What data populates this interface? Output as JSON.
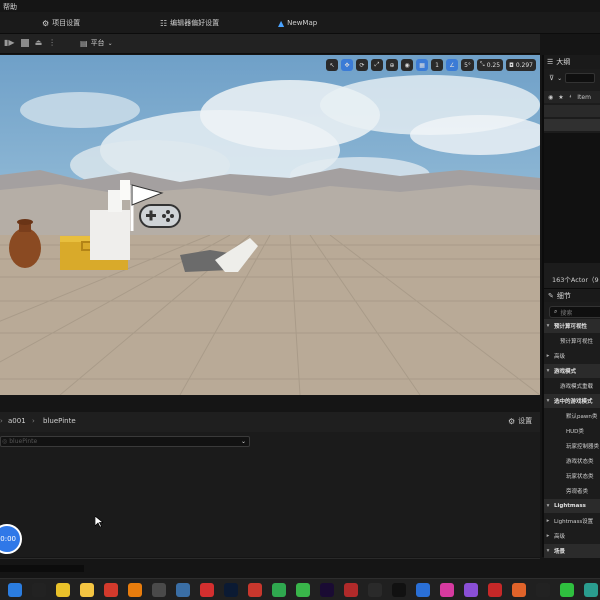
{
  "menubar": {
    "help_label": "帮助"
  },
  "tabs": [
    {
      "label": "项目设置"
    },
    {
      "label": "编辑器偏好设置"
    },
    {
      "label": "NewMap"
    }
  ],
  "toolbar": {
    "platform_label": "平台"
  },
  "viewport": {
    "snap_grid": "1",
    "snap_rotation": "5°",
    "snap_scale": "0.25",
    "camera_speed": "0.297"
  },
  "outliner": {
    "title": "大纲",
    "col_item": "Item",
    "actor_count": "163个Actor（9"
  },
  "details": {
    "title": "细节",
    "search_placeholder": "搜索",
    "rows": [
      {
        "label": "预计算可视性",
        "kind": "section"
      },
      {
        "label": "预计算可视性",
        "kind": "item"
      },
      {
        "label": "高级",
        "kind": "collapsed"
      },
      {
        "label": "游戏模式",
        "kind": "section"
      },
      {
        "label": "游戏模式重载",
        "kind": "item"
      },
      {
        "label": "选中的游戏模式",
        "kind": "section"
      },
      {
        "label": "默认pawn类",
        "kind": "sub"
      },
      {
        "label": "HUD类",
        "kind": "sub"
      },
      {
        "label": "玩家控制器类",
        "kind": "sub"
      },
      {
        "label": "游戏状态类",
        "kind": "sub"
      },
      {
        "label": "玩家状态类",
        "kind": "sub"
      },
      {
        "label": "旁观者类",
        "kind": "sub"
      },
      {
        "label": "Lightmass",
        "kind": "section"
      },
      {
        "label": "Lightmass设置",
        "kind": "collapsed"
      },
      {
        "label": "高级",
        "kind": "collapsed"
      },
      {
        "label": "场景",
        "kind": "section"
      }
    ]
  },
  "content": {
    "breadcrumb": [
      "a001",
      "bluePinte"
    ],
    "settings_label": "设置",
    "path_placeholder": "bluePinte",
    "record_time": "00:00"
  },
  "taskbar": {
    "apps": [
      {
        "name": "windows-start",
        "color": "#2b7de0"
      },
      {
        "name": "capcut",
        "color": "#222222"
      },
      {
        "name": "chrome",
        "color": "#e8c12a"
      },
      {
        "name": "app-yellow",
        "color": "#f4c542"
      },
      {
        "name": "wps",
        "color": "#d33a2c"
      },
      {
        "name": "blender",
        "color": "#e87d0d"
      },
      {
        "name": "unreal-editor",
        "color": "#4a4a4a"
      },
      {
        "name": "gear-app",
        "color": "#3a6ea5"
      },
      {
        "name": "youdao",
        "color": "#d32f2f"
      },
      {
        "name": "photoshop",
        "color": "#0b1a33"
      },
      {
        "name": "app-red",
        "color": "#c8372d"
      },
      {
        "name": "app-green",
        "color": "#2fa84f"
      },
      {
        "name": "app-green-2",
        "color": "#39b54a"
      },
      {
        "name": "after-effects",
        "color": "#1a0b33"
      },
      {
        "name": "app-red-2",
        "color": "#b02a2a"
      },
      {
        "name": "epic-games",
        "color": "#2a2a2a"
      },
      {
        "name": "unreal-engine",
        "color": "#111111"
      },
      {
        "name": "app-blue",
        "color": "#2a6fd6"
      },
      {
        "name": "app-pink",
        "color": "#d63aa0"
      },
      {
        "name": "app-purple",
        "color": "#8a4fd6"
      },
      {
        "name": "app-red-3",
        "color": "#c62828"
      },
      {
        "name": "app-orange",
        "color": "#e0632a"
      },
      {
        "name": "capcut-2",
        "color": "#222222"
      },
      {
        "name": "app-green-3",
        "color": "#2fbf3f"
      },
      {
        "name": "app-teal",
        "color": "#2a9d8f"
      }
    ]
  }
}
